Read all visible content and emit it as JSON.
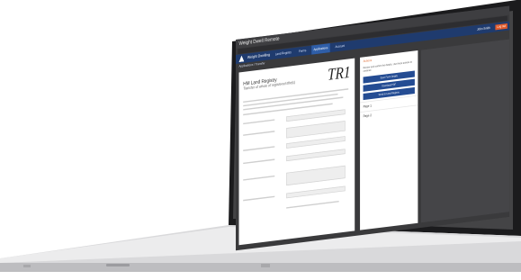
{
  "window": {
    "title": "Weight Dwell Remote"
  },
  "appbar": {
    "brand": "Weight Dwelling",
    "tabs": [
      "Land Registry",
      "Forms",
      "Applications",
      "Account"
    ],
    "active_tab": "Applications",
    "user": "John Smith",
    "logout": "Log out"
  },
  "breadcrumb": "Applications / Transfer",
  "document": {
    "heading": "HM Land Registry",
    "subheading": "Transfer of whole of registered title(s)",
    "form_code": "TR1"
  },
  "panel": {
    "heading": "Actions",
    "text": "Review and confirm the details. Use these actions to continue.",
    "buttons": [
      "Save Form Details",
      "Download PDF",
      "Send to Land Registry"
    ],
    "pages": [
      "Page 1",
      "Page 2"
    ]
  },
  "colors": {
    "brand": "#1f3b6e",
    "accent": "#e0703a",
    "button": "#244c93"
  }
}
